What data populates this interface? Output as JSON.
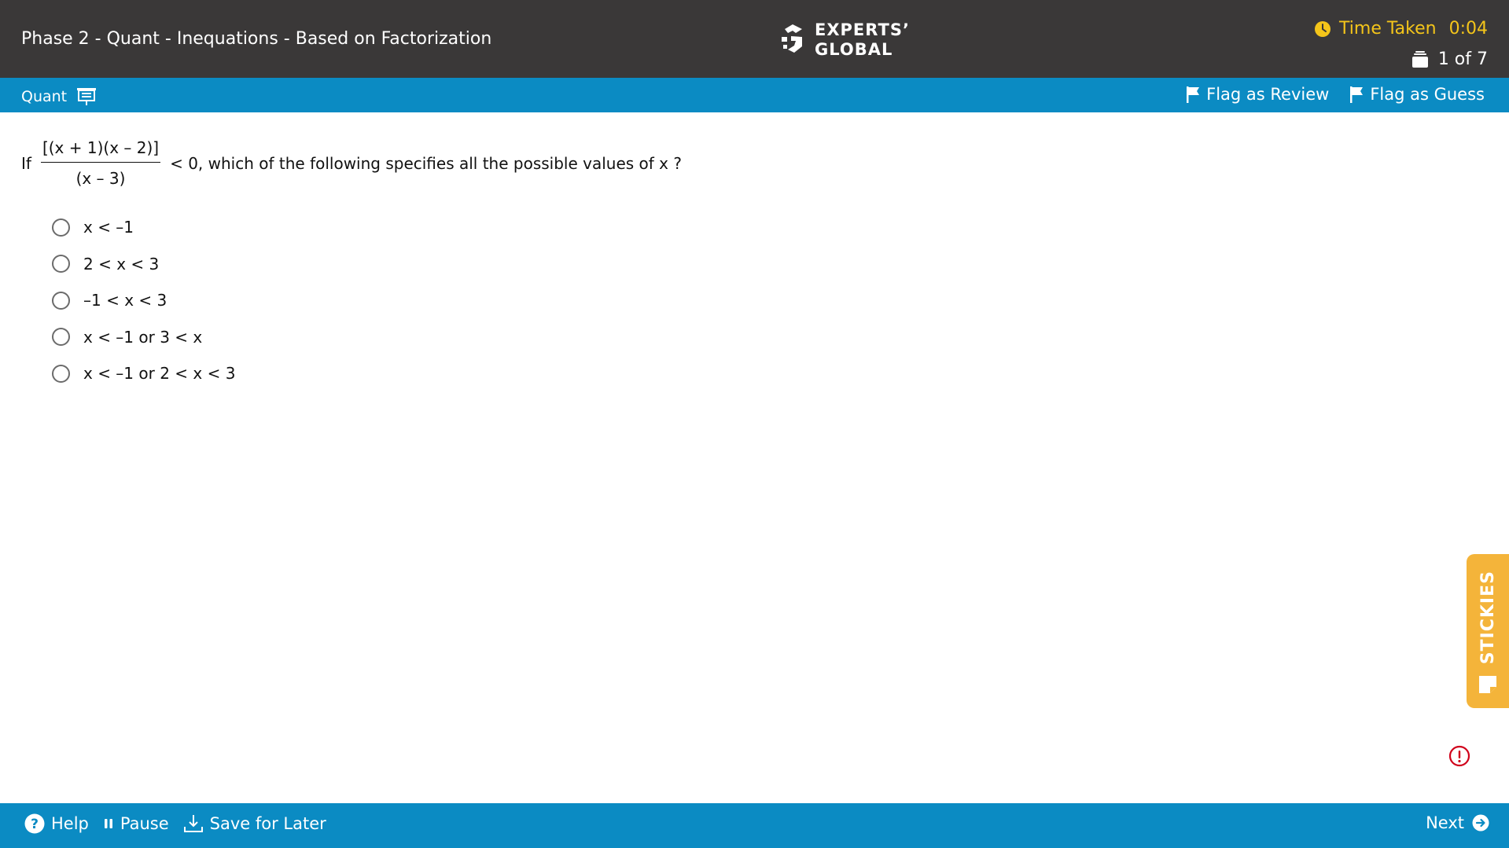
{
  "header": {
    "exam_title": "Phase 2 - Quant - Inequations - Based on Factorization",
    "logo_line1": "EXPERTS’",
    "logo_line2": "GLOBAL",
    "time_label": "Time Taken",
    "time_value": "0:04",
    "question_counter": "1 of 7"
  },
  "section_bar": {
    "section_name": "Quant",
    "flag_review_label": "Flag as Review",
    "flag_guess_label": "Flag as Guess"
  },
  "question": {
    "prefix": "If",
    "numerator": "[(x + 1)(x – 2)]",
    "denominator": "(x – 3)",
    "suffix": "< 0, which of the following specifies all the possible values of x ?",
    "options": [
      "x < –1",
      "2 < x < 3",
      "–1 < x < 3",
      "x < –1 or 3 < x",
      "x < –1 or 2 < x < 3"
    ]
  },
  "stickies_label": "STICKIES",
  "footer": {
    "help_label": "Help",
    "pause_label": "Pause",
    "save_label": "Save for Later",
    "next_label": "Next"
  },
  "colors": {
    "header_bg": "#3a3838",
    "accent_blue": "#0b8bc3",
    "timer_yellow": "#f4c51a",
    "stickies_orange": "#f4b43a",
    "alert_red": "#d0021b"
  }
}
